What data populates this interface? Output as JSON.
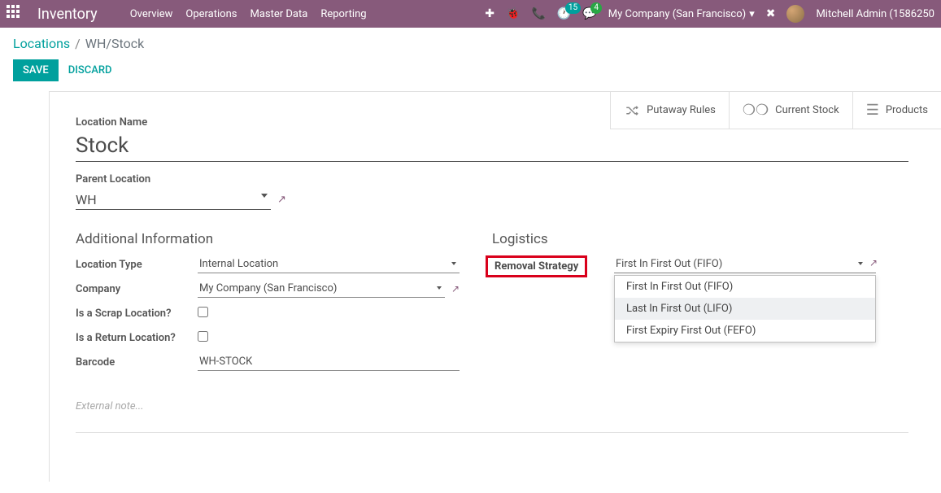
{
  "topbar": {
    "brand": "Inventory",
    "menu": [
      "Overview",
      "Operations",
      "Master Data",
      "Reporting"
    ],
    "badge1": "15",
    "badge2": "4",
    "company": "My Company (San Francisco)",
    "user": "Mitchell Admin (1586250"
  },
  "breadcrumb": {
    "root": "Locations",
    "current": "WH/Stock"
  },
  "actions": {
    "save": "SAVE",
    "discard": "DISCARD"
  },
  "stat_buttons": {
    "putaway": "Putaway Rules",
    "stock": "Current Stock",
    "products": "Products"
  },
  "form": {
    "location_name_label": "Location Name",
    "location_name": "Stock",
    "parent_label": "Parent Location",
    "parent_value": "WH",
    "section_additional": "Additional Information",
    "section_logistics": "Logistics",
    "labels": {
      "location_type": "Location Type",
      "company": "Company",
      "is_scrap": "Is a Scrap Location?",
      "is_return": "Is a Return Location?",
      "barcode": "Barcode",
      "removal": "Removal Strategy"
    },
    "values": {
      "location_type": "Internal Location",
      "company": "My Company (San Francisco)",
      "barcode": "WH-STOCK",
      "removal": "First In First Out (FIFO)"
    },
    "removal_options": [
      "First In First Out (FIFO)",
      "Last In First Out (LIFO)",
      "First Expiry First Out (FEFO)"
    ],
    "note_placeholder": "External note..."
  }
}
